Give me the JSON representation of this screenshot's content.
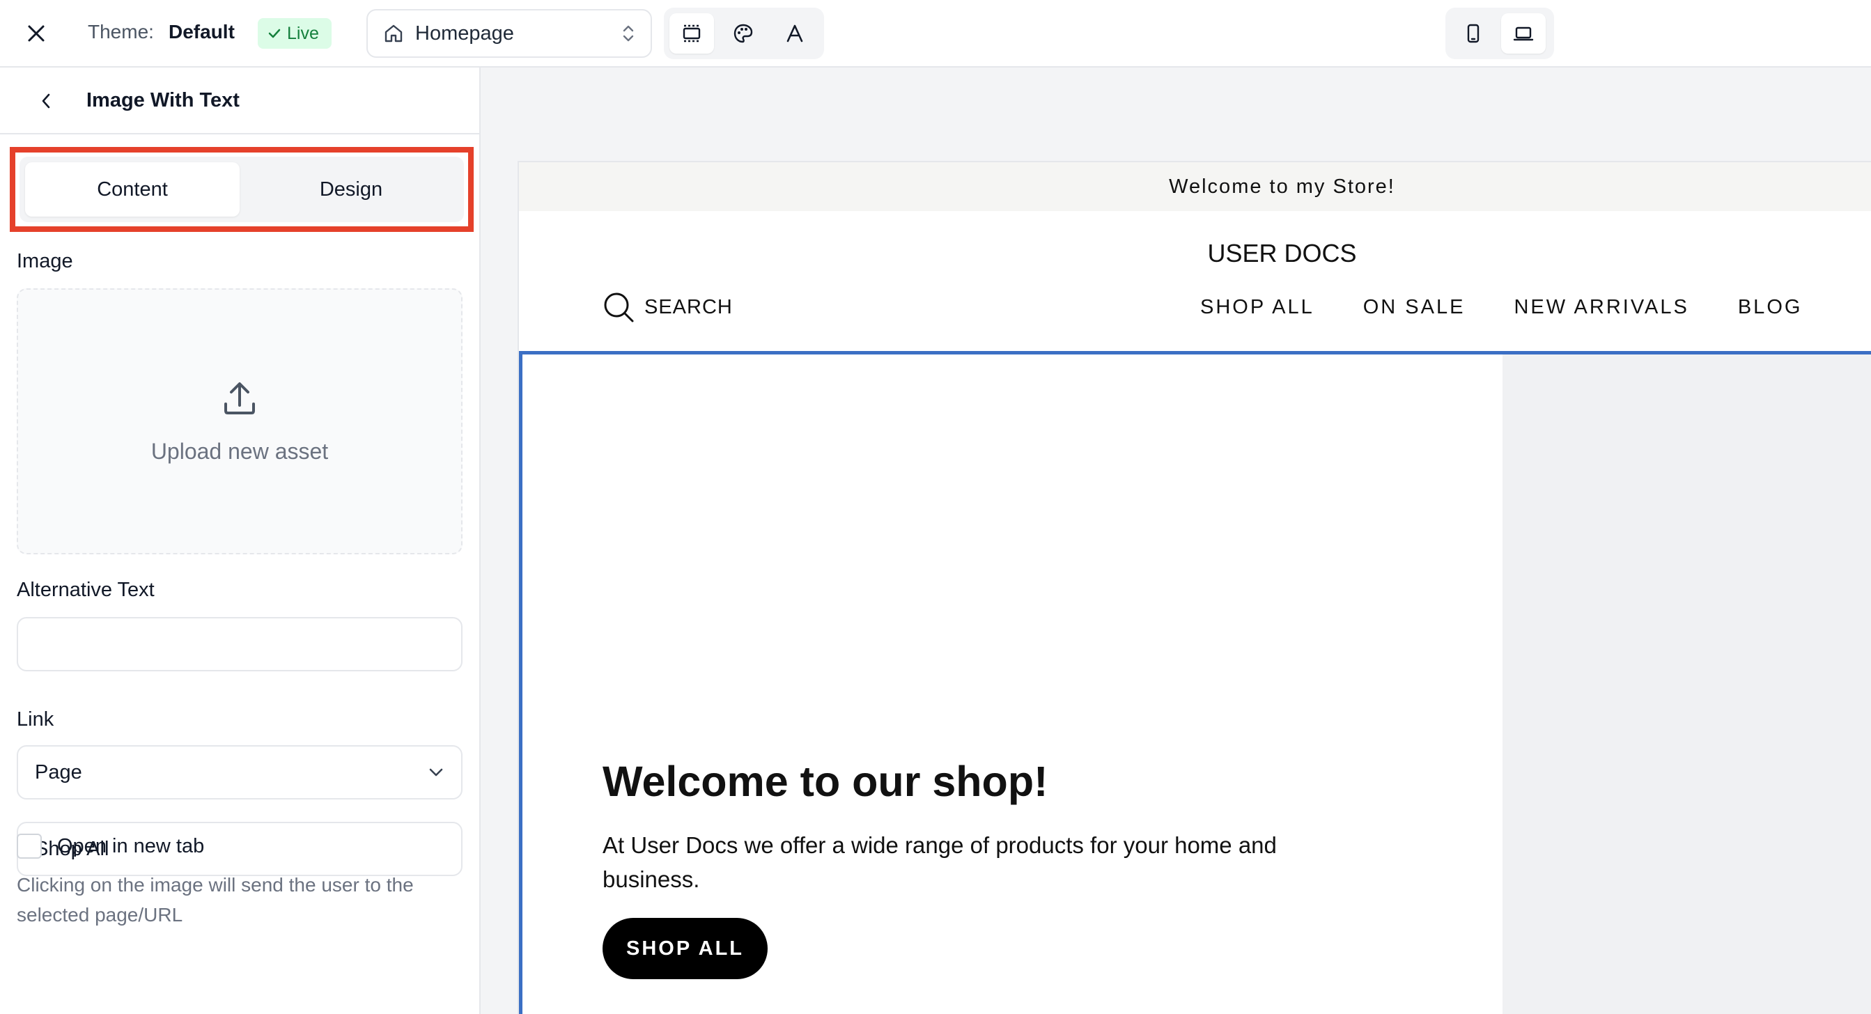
{
  "topbar": {
    "theme_label": "Theme:",
    "theme_name": "Default",
    "status_badge": "Live",
    "page_select": "Homepage",
    "icons": [
      "close-icon",
      "check-icon",
      "home-icon",
      "chevron-up-down-icon",
      "layout-icon",
      "palette-icon",
      "typography-icon",
      "mobile-icon",
      "desktop-icon"
    ]
  },
  "sidebar": {
    "title": "Image With Text",
    "tabs": [
      {
        "label": "Content",
        "active": true
      },
      {
        "label": "Design",
        "active": false
      }
    ],
    "image_label": "Image",
    "upload_label": "Upload new asset",
    "alt_text_label": "Alternative Text",
    "alt_text_value": "",
    "link_label": "Link",
    "link_type": "Page",
    "link_page": "Shop All",
    "open_new_tab_label": "Open in new tab",
    "open_new_tab_checked": false,
    "help_text": "Clicking on the image will send the user to the selected page/URL"
  },
  "preview": {
    "announcement": "Welcome to my Store!",
    "store_name": "USER DOCS",
    "search_label": "SEARCH",
    "nav": [
      "SHOP ALL",
      "ON SALE",
      "NEW ARRIVALS",
      "BLOG"
    ],
    "hero_heading": "Welcome to our shop!",
    "hero_body": "At User Docs we offer a wide range of products for your home and business.",
    "hero_button": "SHOP ALL"
  },
  "colors": {
    "highlight": "#e5412b",
    "selection": "#3b6fc4",
    "live_bg": "#dcfce7",
    "live_text": "#15803d"
  }
}
